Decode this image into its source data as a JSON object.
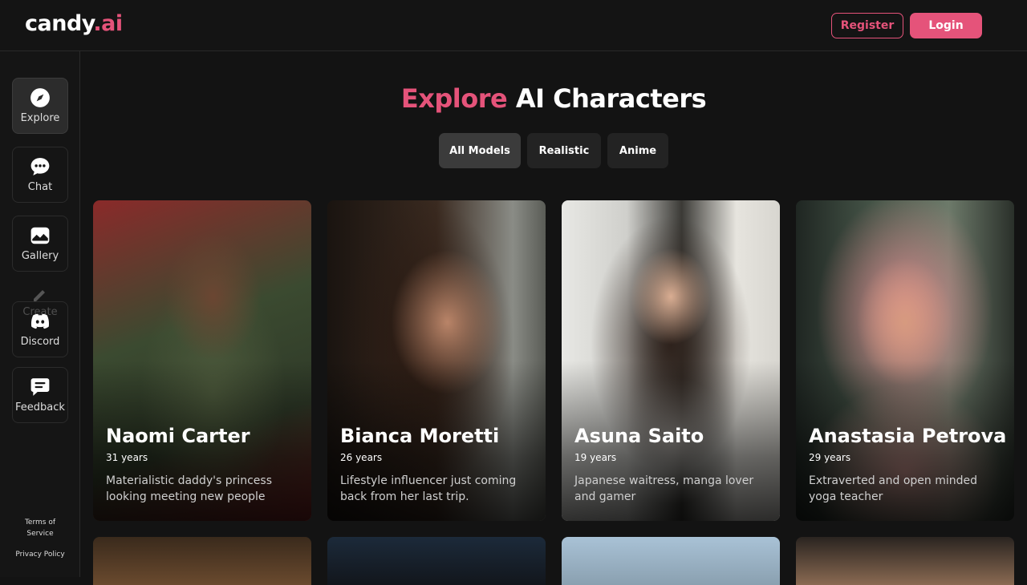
{
  "header": {
    "logo_main": "candy",
    "logo_accent": ".ai",
    "register_label": "Register",
    "login_label": "Login"
  },
  "sidebar": {
    "items": [
      {
        "label": "Explore",
        "icon": "compass-icon"
      },
      {
        "label": "Chat",
        "icon": "chat-bubble-icon"
      },
      {
        "label": "Gallery",
        "icon": "image-icon"
      },
      {
        "label": "Discord",
        "icon": "discord-icon"
      },
      {
        "label": "Feedback",
        "icon": "feedback-icon"
      }
    ],
    "ghost_label": "Create",
    "terms": "Terms of Service",
    "privacy": "Privacy Policy"
  },
  "page": {
    "title_accent": "Explore",
    "title_rest": "AI Characters"
  },
  "filters": [
    "All Models",
    "Realistic",
    "Anime"
  ],
  "characters": [
    {
      "name": "Naomi Carter",
      "age": "31 years",
      "desc": "Materialistic daddy's princess looking meeting new people"
    },
    {
      "name": "Bianca Moretti",
      "age": "26 years",
      "desc": "Lifestyle influencer just coming back from her last trip."
    },
    {
      "name": "Asuna Saito",
      "age": "19 years",
      "desc": "Japanese waitress, manga lover and gamer"
    },
    {
      "name": "Anastasia Petrova",
      "age": "29 years",
      "desc": "Extraverted and open minded yoga teacher"
    }
  ],
  "colors": {
    "accent": "#e5537a",
    "background": "#131313"
  }
}
